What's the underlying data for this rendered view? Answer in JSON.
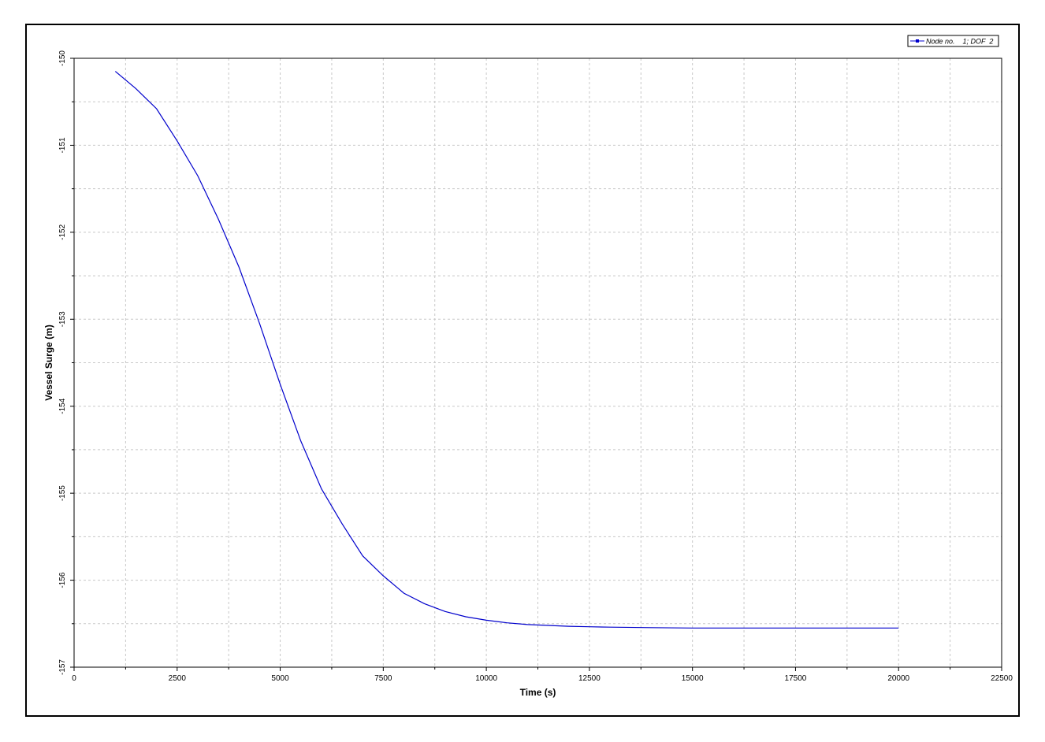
{
  "chart_data": {
    "type": "line",
    "title": "",
    "xlabel": "Time (s)",
    "ylabel": "Vessel Surge (m)",
    "xlim": [
      0,
      22500
    ],
    "ylim": [
      -157,
      -150
    ],
    "grid": true,
    "legend_position": "top-right",
    "x_ticks": [
      0,
      2500,
      5000,
      7500,
      10000,
      12500,
      15000,
      17500,
      20000,
      22500
    ],
    "x_tick_labels": [
      "0",
      "2500",
      "5000",
      "7500",
      "10000",
      "12500",
      "15000",
      "17500",
      "20000",
      "22500"
    ],
    "y_ticks": [
      -150,
      -151,
      -152,
      -153,
      -154,
      -155,
      -156,
      -157
    ],
    "y_tick_labels": [
      "-150",
      "-151",
      "-152",
      "-153",
      "-154",
      "-155",
      "-156",
      "-157"
    ],
    "series": [
      {
        "name": "Node no.    1; DOF  2",
        "color": "#0000cc",
        "x": [
          1000,
          1500,
          2000,
          2500,
          3000,
          3500,
          4000,
          4500,
          5000,
          5500,
          6000,
          6500,
          7000,
          7500,
          8000,
          8500,
          9000,
          9500,
          10000,
          10500,
          11000,
          11500,
          12000,
          12500,
          13000,
          14000,
          15000,
          16000,
          17000,
          18000,
          19000,
          20000
        ],
        "y": [
          -150.15,
          -150.35,
          -150.58,
          -150.95,
          -151.35,
          -151.85,
          -152.4,
          -153.05,
          -153.75,
          -154.4,
          -154.95,
          -155.35,
          -155.72,
          -155.95,
          -156.15,
          -156.27,
          -156.36,
          -156.42,
          -156.46,
          -156.49,
          -156.51,
          -156.52,
          -156.53,
          -156.535,
          -156.54,
          -156.545,
          -156.55,
          -156.55,
          -156.55,
          -156.55,
          -156.55,
          -156.55
        ]
      }
    ]
  }
}
